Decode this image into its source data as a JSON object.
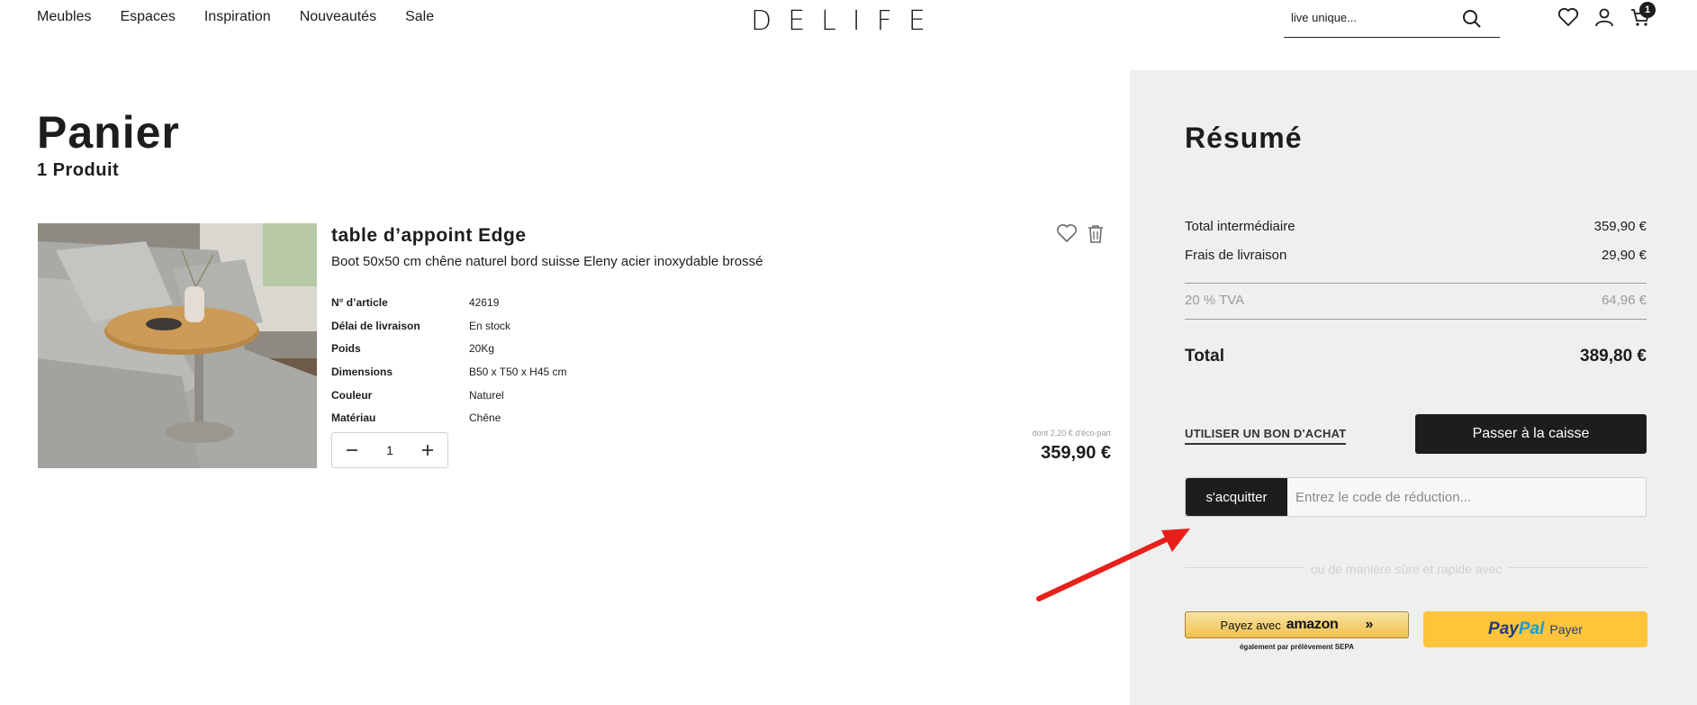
{
  "nav": {
    "items": [
      "Meubles",
      "Espaces",
      "Inspiration",
      "Nouveautés",
      "Sale"
    ]
  },
  "logo": "DELIFE",
  "search": {
    "placeholder": "live unique..."
  },
  "cart_count": "1",
  "cart": {
    "title": "Panier",
    "count": "1 Produit"
  },
  "product": {
    "name": "table d’appoint Edge",
    "description": "Boot 50x50 cm chêne naturel bord suisse Eleny acier inoxydable brossé",
    "specs": [
      {
        "key": "N° d’article",
        "value": "42619"
      },
      {
        "key": "Délai de livraison",
        "value": "En stock"
      },
      {
        "key": "Poids",
        "value": "20Kg"
      },
      {
        "key": "Dimensions",
        "value": "B50 x T50 x H45 cm"
      },
      {
        "key": "Couleur",
        "value": "Naturel"
      },
      {
        "key": "Matériau",
        "value": "Chêne"
      }
    ],
    "quantity": "1",
    "eco_part": "dont 2,20 € d'éco-part",
    "price": "359,90 €"
  },
  "summary": {
    "title": "Résumé",
    "subtotal_label": "Total intermédiaire",
    "subtotal_value": "359,90 €",
    "shipping_label": "Frais de livraison",
    "shipping_value": "29,90 €",
    "vat_label": "20 % TVA",
    "vat_value": "64,96 €",
    "total_label": "Total",
    "total_value": "389,80 €",
    "voucher_link": "UTILISER UN BON D'ACHAT",
    "checkout_label": "Passer à la caisse",
    "coupon_button": "s'acquitter",
    "coupon_placeholder": "Entrez le code de réduction...",
    "or_text": "ou de manière sûre et rapide avec",
    "amazon_label": "Payez avec",
    "amazon_brand": "amazon",
    "amazon_sub": "également par prélèvement SEPA",
    "paypal_brand_1": "Pay",
    "paypal_brand_2": "Pal",
    "paypal_label": "Payer"
  },
  "colors": {
    "dark": "#1d1d1d",
    "panel": "#efefef",
    "amazon": "#f0c14b",
    "paypal": "#ffc439",
    "annotation": "#e8201a"
  }
}
